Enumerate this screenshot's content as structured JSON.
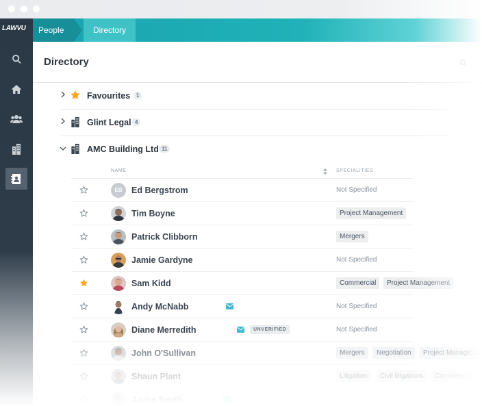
{
  "app": {
    "logo_text": "LAWVU"
  },
  "breadcrumb": {
    "root": "People",
    "current": "Directory"
  },
  "sidebar": {
    "items": [
      {
        "name": "search",
        "icon": "search-icon"
      },
      {
        "name": "home",
        "icon": "home-icon"
      },
      {
        "name": "people",
        "icon": "people-icon"
      },
      {
        "name": "buildings",
        "icon": "building-icon"
      },
      {
        "name": "directory",
        "icon": "contact-book-icon",
        "active": true
      }
    ]
  },
  "page": {
    "title": "Directory"
  },
  "groups": [
    {
      "label": "Favourites",
      "count": "1",
      "icon": "star-icon",
      "expanded": false
    },
    {
      "label": "Glint Legal",
      "count": "4",
      "icon": "building-icon",
      "expanded": false
    },
    {
      "label": "AMC Building Ltd",
      "count": "11",
      "icon": "building-icon",
      "expanded": true
    }
  ],
  "table": {
    "columns": {
      "name": "NAME",
      "specialities": "SPECIALITIES"
    },
    "rows": [
      {
        "name": "Ed Bergstrom",
        "initials": "EB",
        "favourite": false,
        "specialities": [],
        "none_text": "Not Specified"
      },
      {
        "name": "Tim Boyne",
        "favourite": false,
        "specialities": [
          "Project Management"
        ]
      },
      {
        "name": "Patrick Clibborn",
        "favourite": false,
        "specialities": [
          "Mergers"
        ]
      },
      {
        "name": "Jamie Gardyne",
        "favourite": false,
        "specialities": [],
        "none_text": "Not Specified"
      },
      {
        "name": "Sam Kidd",
        "favourite": true,
        "specialities": [
          "Commercial",
          "Project Management"
        ]
      },
      {
        "name": "Andy McNabb",
        "favourite": false,
        "email": true,
        "specialities": [],
        "none_text": "Not Specified"
      },
      {
        "name": "Diane Merredith",
        "favourite": false,
        "email": true,
        "unverified": "UNVERIFIED",
        "specialities": [],
        "none_text": "Not Specified"
      },
      {
        "name": "John O'Sullivan",
        "favourite": false,
        "specialities": [
          "Mergers",
          "Negotiation",
          "Project Manage..."
        ]
      },
      {
        "name": "Shaun Plant",
        "favourite": false,
        "specialities": [
          "Litigation",
          "Civil litigations",
          "Commerci..."
        ]
      },
      {
        "name": "Andre Smith",
        "favourite": false,
        "email": true,
        "specialities": []
      }
    ]
  },
  "colors": {
    "accent": "#20b2b8",
    "sidebar": "#2e3c4a",
    "star_active": "#f5a623"
  }
}
